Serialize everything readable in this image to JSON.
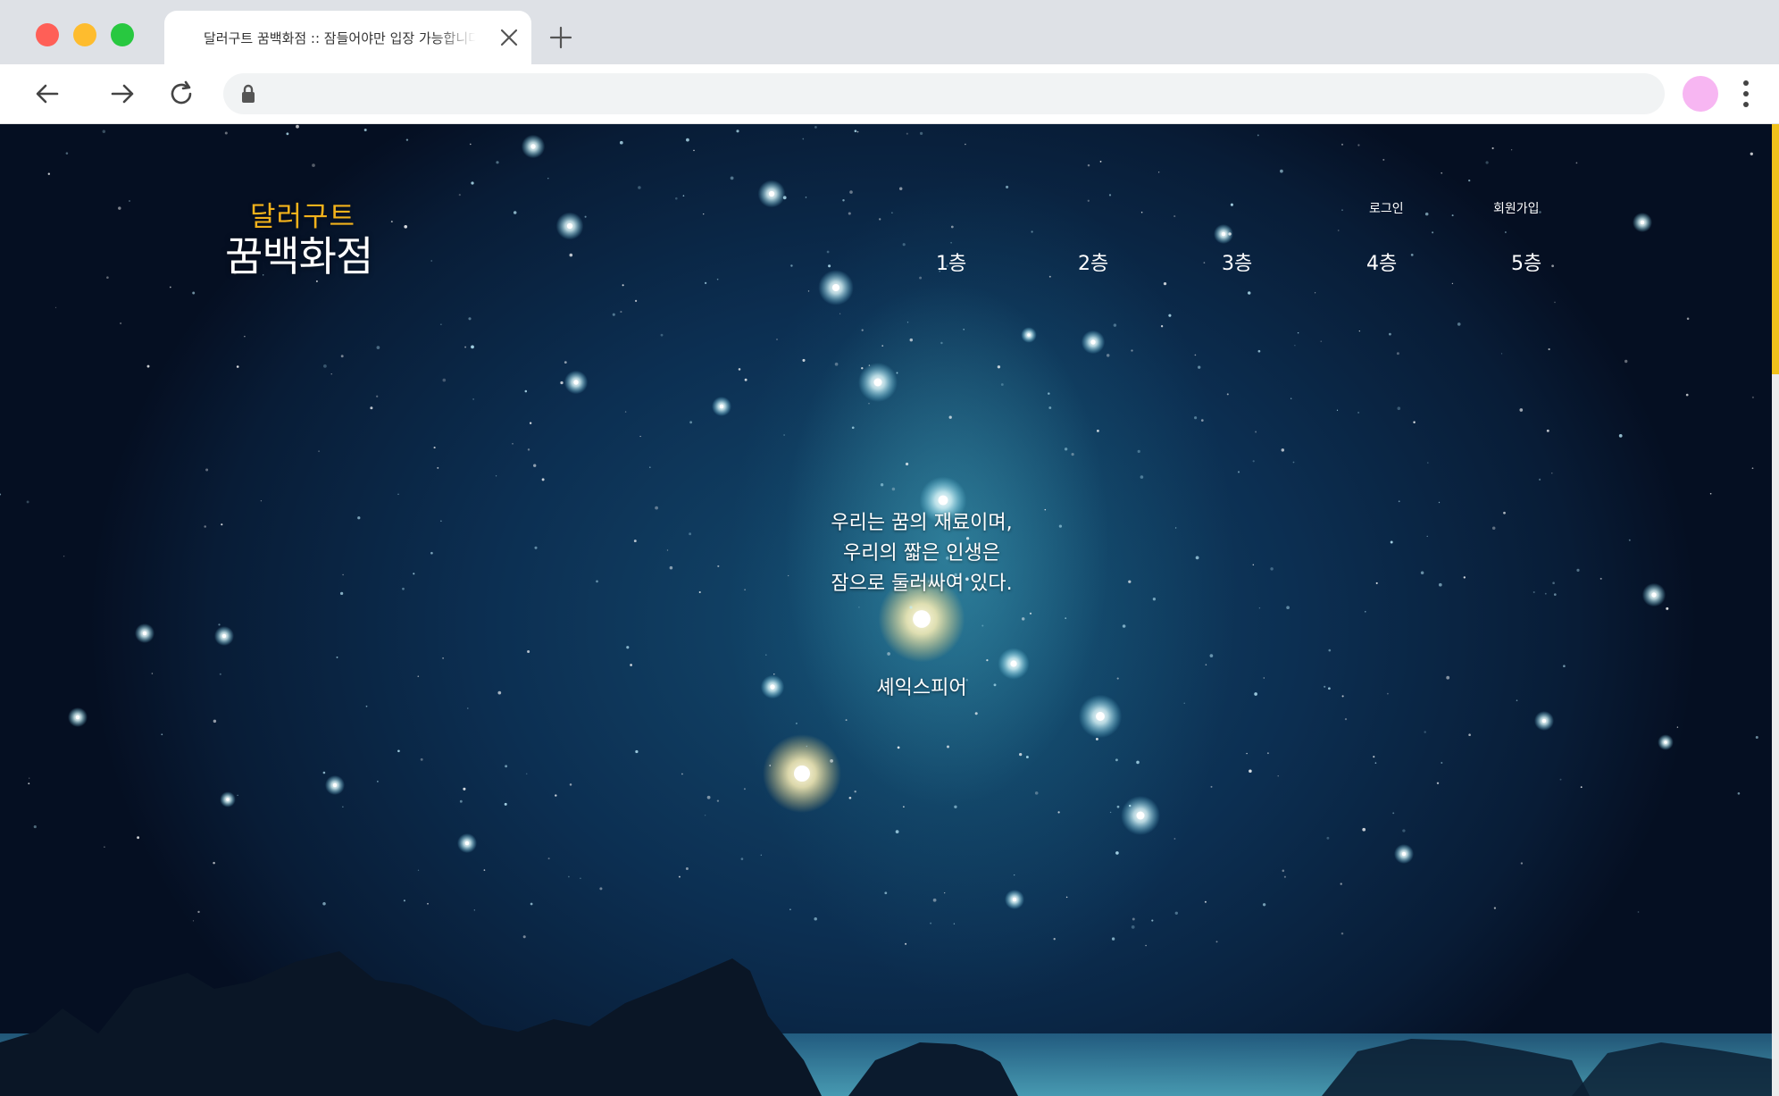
{
  "browser": {
    "tab_title": "달러구트 꿈백화점 :: 잠들어야만 입장 가능합니다",
    "url": "",
    "icons": {
      "tab_close": "close-icon",
      "new_tab": "plus-icon",
      "back": "arrow-left-icon",
      "forward": "arrow-right-icon",
      "reload": "reload-icon",
      "lock": "lock-icon",
      "menu": "more-vertical-icon"
    },
    "colors": {
      "traffic_red": "#ff5f57",
      "traffic_yellow": "#febc2e",
      "traffic_green": "#28c840",
      "profile": "#f7b6f2",
      "scrollbar_thumb": "#f0c21a"
    }
  },
  "site": {
    "logo": {
      "top": "달러구트",
      "bottom": "꿈백화점",
      "top_color": "#f2b21c"
    },
    "util_links": {
      "login": "로그인",
      "signup": "회원가입"
    },
    "floors": [
      "1층",
      "2층",
      "3층",
      "4층",
      "5층"
    ],
    "quote": {
      "lines": [
        "우리는 꿈의 재료이며,",
        "우리의 짧은 인생은",
        "잠으로 둘러싸여 있다."
      ],
      "author": "셰익스피어"
    }
  }
}
